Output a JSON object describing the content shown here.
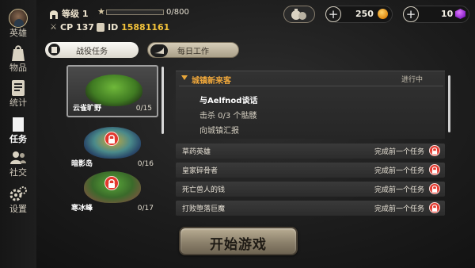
{
  "sidebar": {
    "items": [
      {
        "label": "英雄",
        "icon": "hero-avatar-icon"
      },
      {
        "label": "物品",
        "icon": "items-icon"
      },
      {
        "label": "统计",
        "icon": "stats-icon"
      },
      {
        "label": "任务",
        "icon": "quests-icon",
        "active": true
      },
      {
        "label": "社交",
        "icon": "social-icon"
      },
      {
        "label": "设置",
        "icon": "settings-icon"
      }
    ]
  },
  "header": {
    "level_label": "等级 1",
    "xp_text": "0/800",
    "xp_progress": 0,
    "cp_label": "CP 137",
    "id_label": "ID",
    "id_value": "15881161",
    "gold_value": "250",
    "gem_value": "10"
  },
  "tabs": [
    {
      "label": "战役任务",
      "active": true
    },
    {
      "label": "每日工作",
      "active": false
    }
  ],
  "regions": [
    {
      "name": "云雀旷野",
      "count": "0/15",
      "locked": false,
      "selected": true
    },
    {
      "name": "暗影岛",
      "count": "0/16",
      "locked": true,
      "selected": false
    },
    {
      "name": "寒冰峰",
      "count": "0/17",
      "locked": true,
      "selected": false
    }
  ],
  "quest_panel": {
    "title": "城镇新来客",
    "status": "进行中",
    "objectives": [
      "与Aelfnod谈话",
      "击杀 0/3 个骷髅",
      "向城镇汇报"
    ]
  },
  "quests": [
    {
      "name": "草药英雄",
      "requirement": "完成前一个任务"
    },
    {
      "name": "皇家碎骨者",
      "requirement": "完成前一个任务"
    },
    {
      "name": "死亡兽人的钱",
      "requirement": "完成前一个任务"
    },
    {
      "name": "打败堕落巨魔",
      "requirement": "完成前一个任务"
    }
  ],
  "start_button": "开始游戏",
  "colors": {
    "accent_orange": "#f2a93b",
    "lock_red": "#e2382e",
    "gold": "#e08a12",
    "gem": "#8a22c8"
  }
}
